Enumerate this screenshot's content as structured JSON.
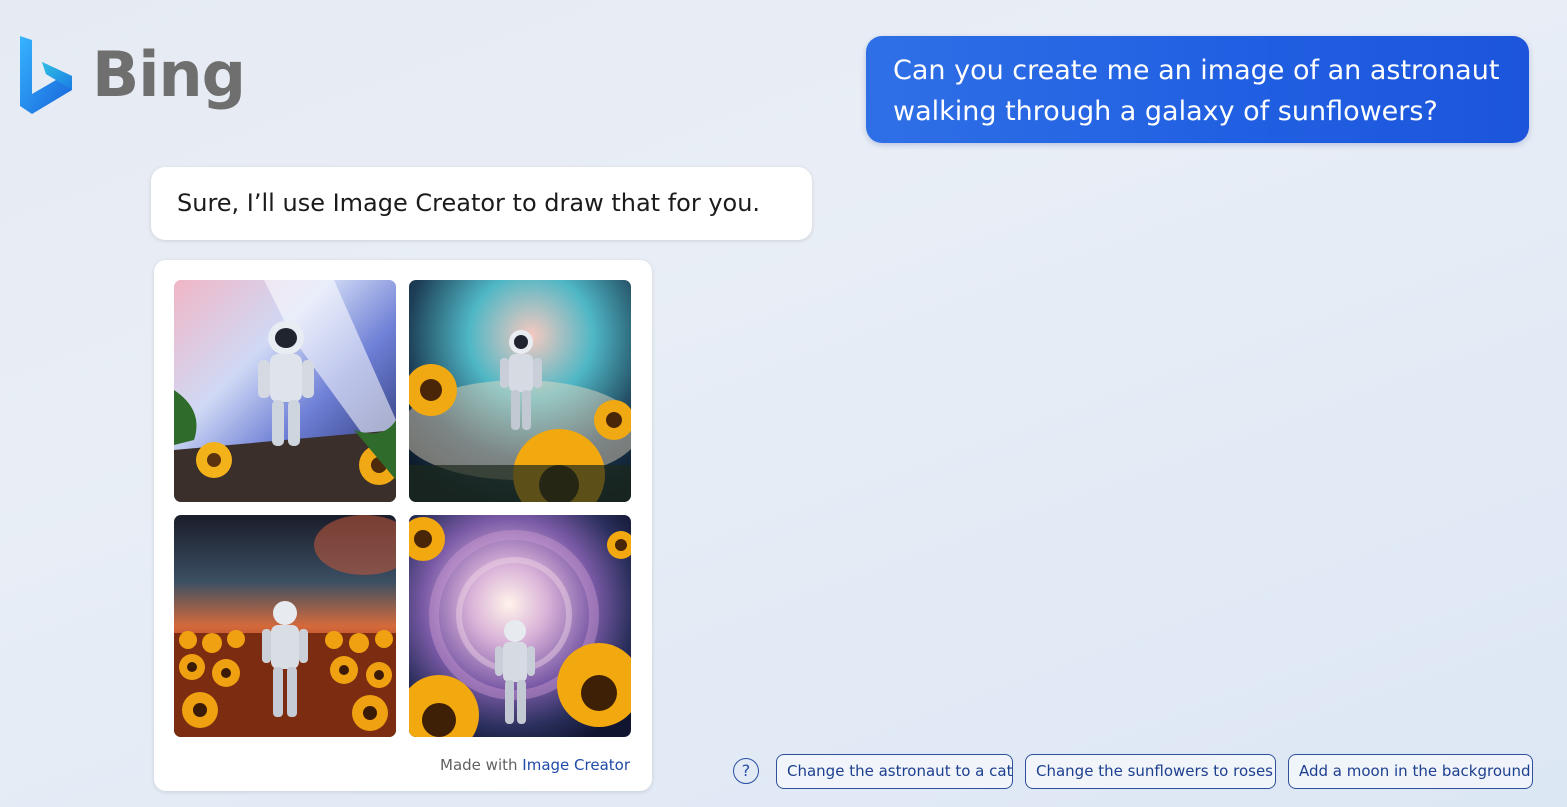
{
  "brand": {
    "name": "Bing",
    "logo_icon": "bing-logo-icon"
  },
  "conversation": {
    "user_message": "Can you create me an image of an astronaut walking through a galaxy of sunflowers?",
    "bot_message": "Sure, I’ll use Image Creator to draw that for you.",
    "image_results": {
      "images": [
        {
          "icon": "astronaut-sunflowers-image-1"
        },
        {
          "icon": "astronaut-sunflowers-image-2"
        },
        {
          "icon": "astronaut-sunflowers-image-3"
        },
        {
          "icon": "astronaut-sunflowers-image-4"
        }
      ],
      "credit_prefix": "Made with",
      "credit_link": "Image Creator"
    }
  },
  "suggestions": {
    "help_icon": "question-mark-icon",
    "help_glyph": "?",
    "items": [
      "Change the astronaut to a cat",
      "Change the sunflowers to roses",
      "Add a moon in the background"
    ]
  },
  "colors": {
    "user_bubble": "#2160e2",
    "link": "#1f4aa8",
    "suggestion_border": "#2e4f99"
  }
}
